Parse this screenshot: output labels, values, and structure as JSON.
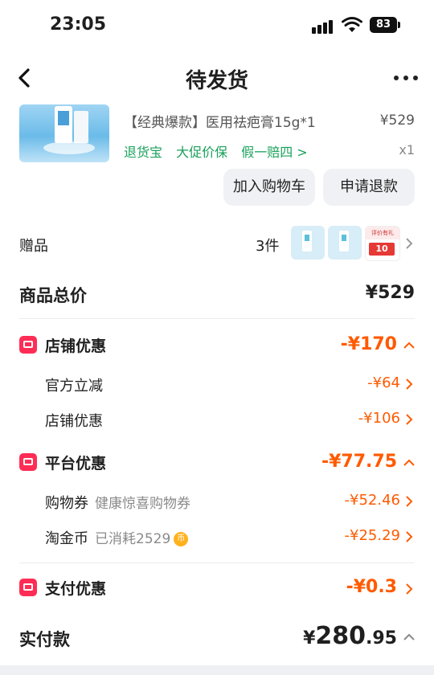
{
  "status_bar": {
    "time": "23:05",
    "battery": "83"
  },
  "header": {
    "title": "待发货"
  },
  "product": {
    "name": "【经典爆款】医用祛疤膏15g*1",
    "price": "¥529",
    "tags": [
      "退货宝",
      "大促价保",
      "假一赔四 >"
    ],
    "quantity": "x1",
    "add_to_cart_label": "加入购物车",
    "refund_label": "申请退款"
  },
  "gifts": {
    "label": "赠品",
    "count": "3件",
    "badge_top": "评价有礼",
    "badge_num": "10"
  },
  "goods_total": {
    "label": "商品总价",
    "value": "¥529"
  },
  "store_discount": {
    "label": "店铺优惠",
    "value": "-¥170",
    "items": [
      {
        "label": "官方立减",
        "desc": "",
        "value": "-¥64"
      },
      {
        "label": "店铺优惠",
        "desc": "",
        "value": "-¥106"
      }
    ]
  },
  "platform_discount": {
    "label": "平台优惠",
    "value": "-¥77.75",
    "items": [
      {
        "label": "购物券",
        "desc": "健康惊喜购物券",
        "value": "-¥52.46"
      },
      {
        "label": "淘金币",
        "desc": "已消耗2529",
        "value": "-¥25.29"
      }
    ]
  },
  "payment_discount": {
    "label": "支付优惠",
    "value": "-¥0.3"
  },
  "paid": {
    "label": "实付款",
    "currency": "¥",
    "integer": "280",
    "decimal": ".95"
  },
  "colors": {
    "accent": "#ff5a00",
    "green": "#1aa05b",
    "icon_red": "#ff2d55"
  }
}
